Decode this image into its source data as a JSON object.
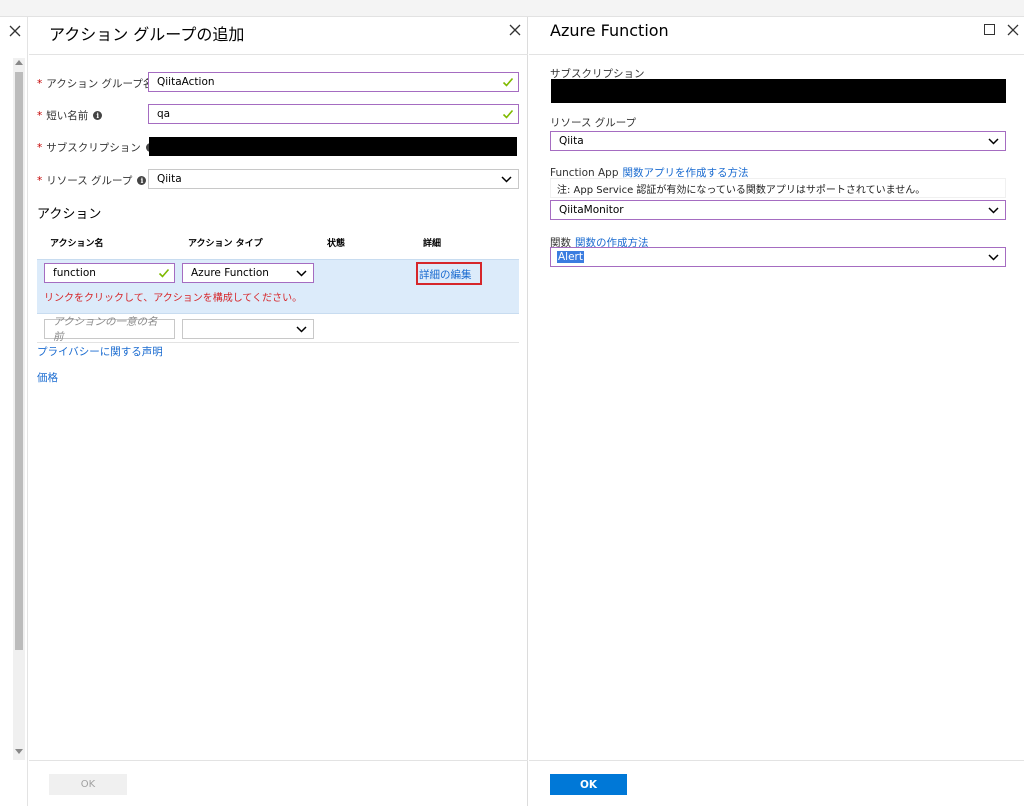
{
  "blade_left": {
    "title": "アクション グループの追加",
    "fields": {
      "group_name": {
        "label": "アクション グループ名",
        "value": "QiitaAction"
      },
      "short_name": {
        "label": "短い名前",
        "value": "qa"
      },
      "subscription": {
        "label": "サブスクリプション"
      },
      "resource_group": {
        "label": "リソース グループ",
        "value": "Qiita"
      }
    },
    "actions_section": {
      "title": "アクション",
      "headers": {
        "name": "アクション名",
        "type": "アクション タイプ",
        "status": "状態",
        "details": "詳細"
      },
      "row": {
        "name": "function",
        "type": "Azure Function",
        "details_link": "詳細の編集",
        "error": "リンクをクリックして、アクションを構成してください。"
      },
      "new_row": {
        "name_placeholder": "アクションの一意の名前"
      }
    },
    "links": {
      "privacy": "プライバシーに関する声明",
      "pricing": "価格"
    },
    "ok_label": "OK"
  },
  "blade_right": {
    "title": "Azure Function",
    "subscription_label": "サブスクリプション",
    "resource_group": {
      "label": "リソース グループ",
      "value": "Qiita"
    },
    "function_app": {
      "label": "Function App",
      "link": "関数アプリを作成する方法",
      "note": "注: App Service 認証が有効になっている関数アプリはサポートされていません。",
      "value": "QiitaMonitor"
    },
    "function": {
      "label": "関数",
      "link": "関数の作成方法",
      "value": "Alert"
    },
    "ok_label": "OK"
  },
  "colors": {
    "accent_border": "#a56cc1",
    "primary": "#0078d7",
    "link": "#1a6bd0",
    "error": "#d6262a",
    "valid": "#7fba00"
  }
}
